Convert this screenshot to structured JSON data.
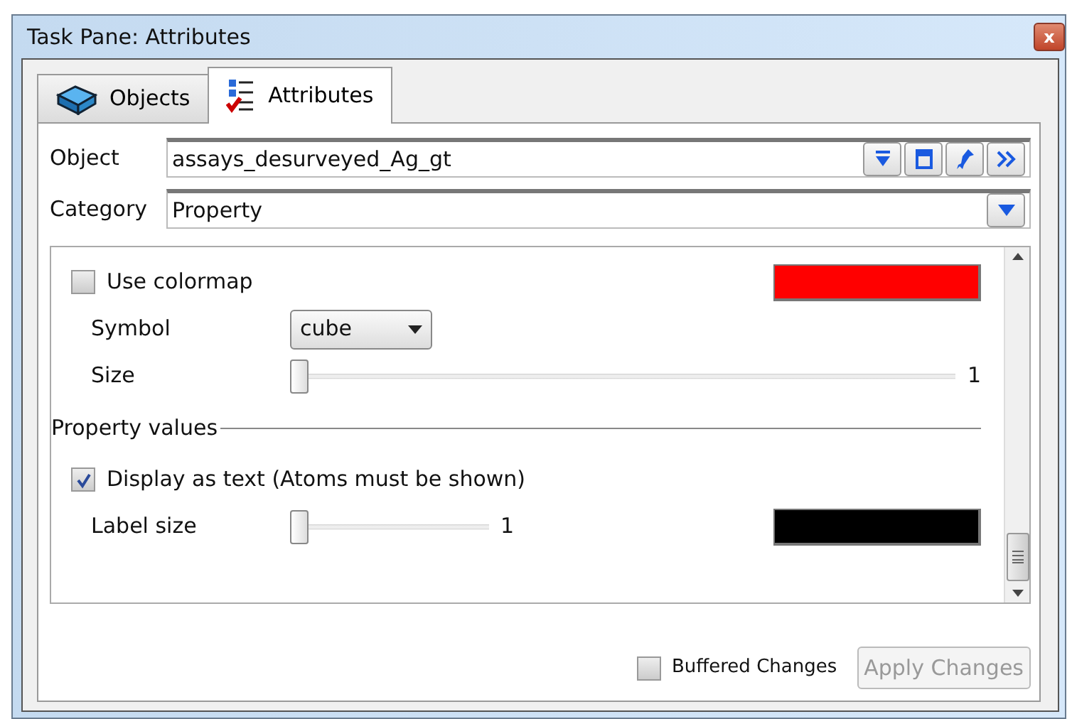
{
  "window": {
    "title": "Task Pane: Attributes",
    "close": "x"
  },
  "tabs": [
    {
      "label": "Objects",
      "selected": false
    },
    {
      "label": "Attributes",
      "selected": true
    }
  ],
  "object": {
    "label": "Object",
    "value": "assays_desurveyed_Ag_gt"
  },
  "category": {
    "label": "Category",
    "value": "Property"
  },
  "settings": [
    {
      "kind": "checkbox",
      "label": "Use colormap",
      "checked": false,
      "color": "#ff0000"
    },
    {
      "kind": "select",
      "label": "Symbol",
      "value": "cube"
    },
    {
      "kind": "slider",
      "label": "Size",
      "level": 0,
      "reading": "1"
    },
    {
      "kind": "group",
      "label": "Property values"
    },
    {
      "kind": "checkbox",
      "label": "Display as text (Atoms must be shown)",
      "checked": true
    },
    {
      "kind": "slider",
      "label": "Label size",
      "level": 0,
      "reading": "1",
      "color": "#000000"
    }
  ],
  "footer": {
    "buffered": {
      "label": "Buffered Changes",
      "checked": false
    },
    "apply": {
      "label": "Apply Changes",
      "disabled": true
    }
  }
}
